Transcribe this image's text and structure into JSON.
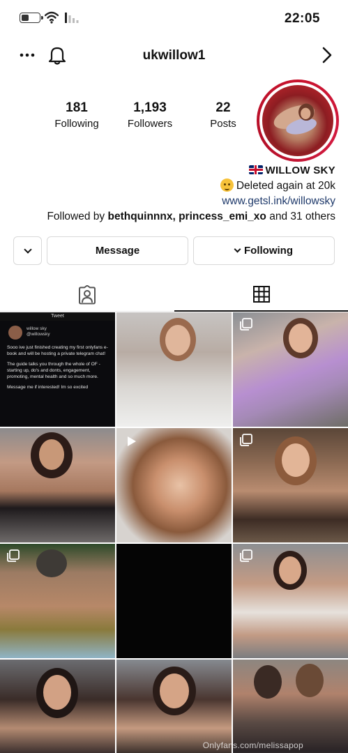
{
  "status_bar": {
    "time": "22:05",
    "battery_level": 0.4
  },
  "nav": {
    "username": "ukwillow1",
    "icons": [
      "back-icon",
      "bell-icon",
      "more-icon"
    ]
  },
  "profile": {
    "stats": [
      {
        "count": "22",
        "label": "Posts"
      },
      {
        "count": "1,193",
        "label": "Followers"
      },
      {
        "count": "181",
        "label": "Following"
      }
    ],
    "display_name": "WILLOW SKY",
    "bio_line": "Deleted again at 20k",
    "link": "www.getsl.ink/willowsky",
    "followed_prefix": "Followed by",
    "followed_users": "bethquinnnx, princess_emi_xo",
    "followed_suffix": "and 31 others"
  },
  "actions": {
    "following_label": "Following",
    "message_label": "Message"
  },
  "tabs": [
    "grid-icon",
    "tagged-icon"
  ],
  "tweet_post": {
    "header": "Tweet",
    "author": "willow sky",
    "handle": "@willowsky",
    "paragraphs": [
      "Sooo ive just finished creating my first onlyfans e-book and will be hosting a private telegram chat!",
      "The guide talks you through the whole of OF - starting up, do's and donts, engagement, promoting, mental health and so much more.",
      "Message me if interested! Im so excited"
    ]
  },
  "watermark": "Onlyfans.com/melissapop",
  "colors": {
    "avatar_ring": "#c8132d",
    "link": "#1f3a6b",
    "border": "#d8d8d8"
  }
}
